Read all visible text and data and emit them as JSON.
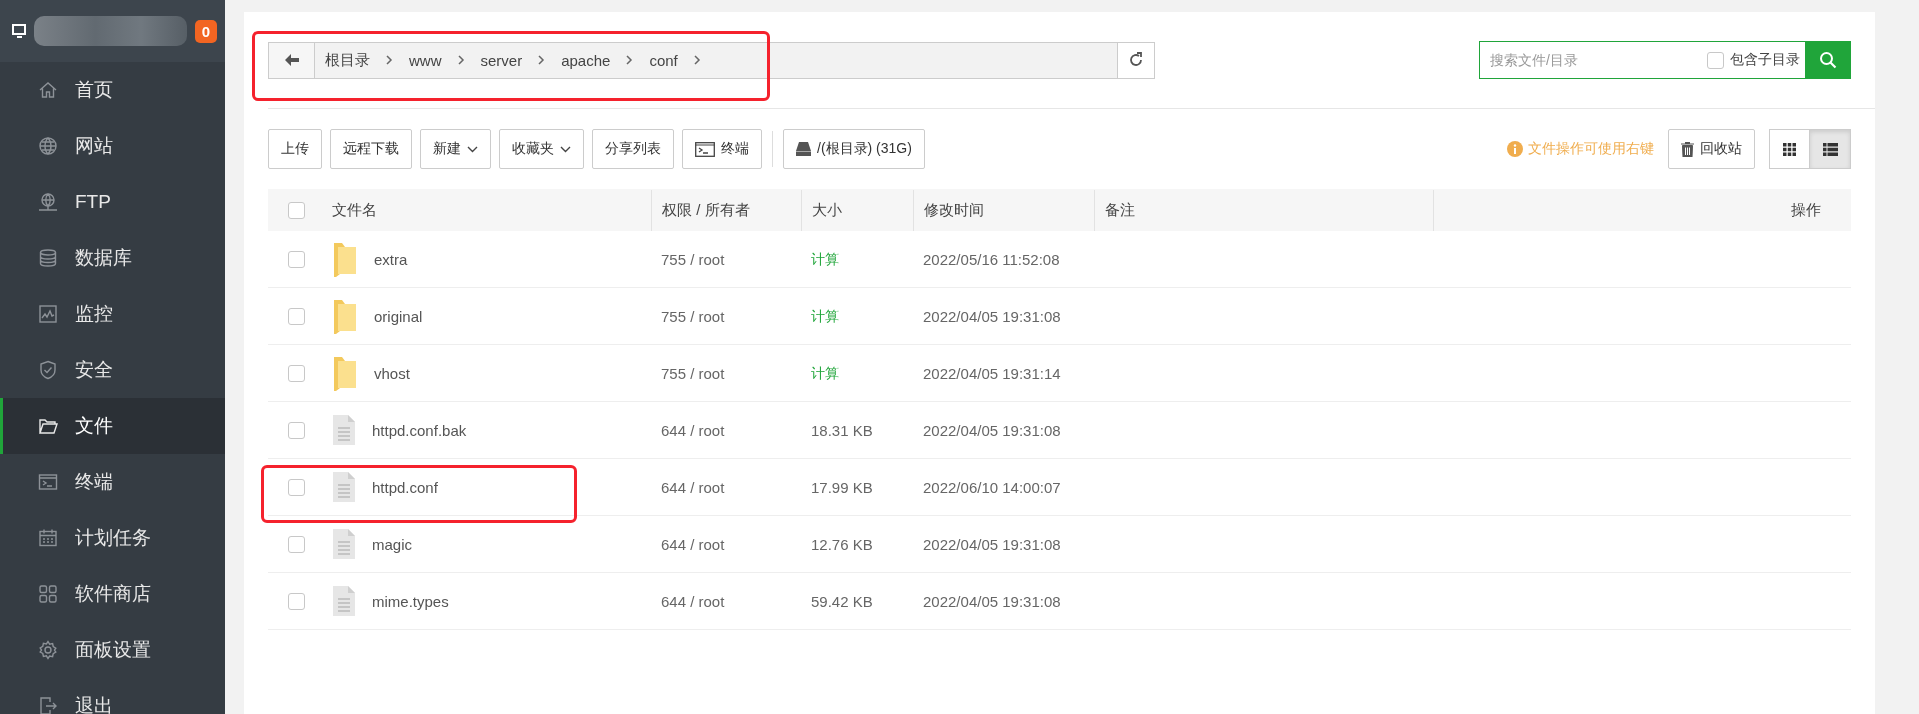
{
  "sidebar": {
    "badge": "0",
    "items": [
      {
        "label": "首页",
        "kind": "home",
        "selected": false
      },
      {
        "label": "网站",
        "kind": "globe",
        "selected": false
      },
      {
        "label": "FTP",
        "kind": "ftp",
        "selected": false
      },
      {
        "label": "数据库",
        "kind": "database",
        "selected": false
      },
      {
        "label": "监控",
        "kind": "monitor",
        "selected": false
      },
      {
        "label": "安全",
        "kind": "shield",
        "selected": false
      },
      {
        "label": "文件",
        "kind": "folder",
        "selected": true
      },
      {
        "label": "终端",
        "kind": "terminal",
        "selected": false
      },
      {
        "label": "计划任务",
        "kind": "calendar",
        "selected": false
      },
      {
        "label": "软件商店",
        "kind": "apps",
        "selected": false
      },
      {
        "label": "面板设置",
        "kind": "gear",
        "selected": false
      },
      {
        "label": "退出",
        "kind": "logout",
        "selected": false
      }
    ]
  },
  "breadcrumb": {
    "highlighted": true,
    "items": [
      "根目录",
      "www",
      "server",
      "apache",
      "conf"
    ]
  },
  "search": {
    "placeholder": "搜索文件/目录",
    "include_subdirs": {
      "label": "包含子目录",
      "checked": false
    }
  },
  "toolbar": {
    "buttons": [
      {
        "label": "上传",
        "kind": "plain"
      },
      {
        "label": "远程下载",
        "kind": "plain"
      },
      {
        "label": "新建",
        "kind": "dropdown"
      },
      {
        "label": "收藏夹",
        "kind": "dropdown"
      },
      {
        "label": "分享列表",
        "kind": "plain"
      },
      {
        "label": "终端",
        "kind": "terminal"
      }
    ],
    "disk": "/(根目录) (31G)",
    "hint": "文件操作可使用右键",
    "recycle": "回收站",
    "views": [
      {
        "kind": "grid",
        "selected": false
      },
      {
        "kind": "list",
        "selected": true
      }
    ]
  },
  "table": {
    "all_checked": false,
    "columns": [
      "文件名",
      "权限 / 所有者",
      "大小",
      "修改时间",
      "备注",
      "操作"
    ],
    "rows": [
      {
        "kind": "folder",
        "name": "extra",
        "perm": "755 / root",
        "size": "计算",
        "modified": "2022/05/16 11:52:08",
        "checked": false,
        "highlighted": false
      },
      {
        "kind": "folder",
        "name": "original",
        "perm": "755 / root",
        "size": "计算",
        "modified": "2022/04/05 19:31:08",
        "checked": false,
        "highlighted": false
      },
      {
        "kind": "folder",
        "name": "vhost",
        "perm": "755 / root",
        "size": "计算",
        "modified": "2022/04/05 19:31:14",
        "checked": false,
        "highlighted": false
      },
      {
        "kind": "file",
        "name": "httpd.conf.bak",
        "perm": "644 / root",
        "size": "18.31 KB",
        "modified": "2022/04/05 19:31:08",
        "checked": false,
        "highlighted": false
      },
      {
        "kind": "file",
        "name": "httpd.conf",
        "perm": "644 / root",
        "size": "17.99 KB",
        "modified": "2022/06/10 14:00:07",
        "checked": false,
        "highlighted": true
      },
      {
        "kind": "file",
        "name": "magic",
        "perm": "644 / root",
        "size": "12.76 KB",
        "modified": "2022/04/05 19:31:08",
        "checked": false,
        "highlighted": false
      },
      {
        "kind": "file",
        "name": "mime.types",
        "perm": "644 / root",
        "size": "59.42 KB",
        "modified": "2022/04/05 19:31:08",
        "checked": false,
        "highlighted": false
      }
    ]
  }
}
